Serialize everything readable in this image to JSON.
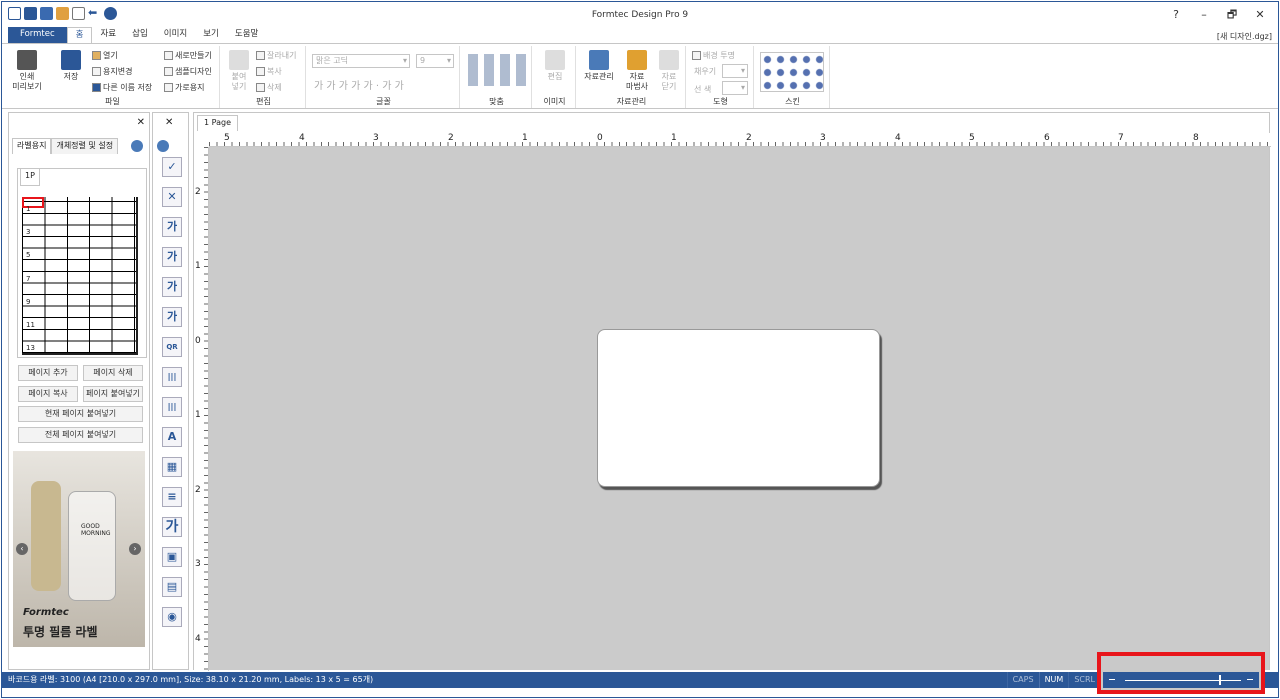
{
  "window": {
    "title": "Formtec Design Pro 9",
    "doc_name": "[새 디자인.dgz]",
    "controls": [
      "?",
      "–",
      "🗗",
      "✕"
    ]
  },
  "ribbon_tabs": [
    "Formtec",
    "홈",
    "자료",
    "삽입",
    "이미지",
    "보기",
    "도움말"
  ],
  "groups": {
    "file": {
      "label": "파일",
      "print": "인쇄\n미리보기",
      "save": "저장",
      "open": "열기",
      "paper": "용지변경",
      "saveas": "다른 이름 저장",
      "new": "새로만들기",
      "sample": "샘플디자인",
      "landscape": "가로용지"
    },
    "edit": {
      "label": "편집",
      "paste": "붙여\n넣기",
      "cut": "잘라내기",
      "copy": "복사",
      "delete": "삭제"
    },
    "font": {
      "label": "글꼴",
      "family": "맑은 고딕",
      "size": "9",
      "styles": "가 가 가 가 가 · 가 가"
    },
    "align": {
      "label": "맞춤"
    },
    "image": {
      "label": "이미지",
      "edit": "편집"
    },
    "data": {
      "label": "자료관리",
      "manage": "자료관리",
      "wizard": "자료\n마법사",
      "close": "자료\n닫기"
    },
    "shape": {
      "label": "도형",
      "transparent": "배경 투명",
      "fill": "채우기",
      "line": "선  색"
    },
    "skin": {
      "label": "스킨"
    }
  },
  "left_panel": {
    "tabs": [
      "라벨용지",
      "개체정렬 및 설정"
    ],
    "page_tab": "1P",
    "row_numbers": [
      "1",
      "3",
      "5",
      "7",
      "9",
      "11",
      "13"
    ],
    "buttons": {
      "add_page": "페이지 추가",
      "delete_page": "페이지 삭제",
      "copy_page": "페이지 복사",
      "paste_page": "페이지 붙여넣기",
      "paste_current": "현재 페이지 붙여넣기",
      "paste_all": "전체 페이지 붙여넣기"
    },
    "ad": {
      "brand": "Formtec",
      "title": "투명 필름 라벨",
      "bottle_text": "GOOD\nMORNING"
    }
  },
  "toolbox": [
    "✓",
    "✕",
    "가",
    "가",
    "가",
    "가",
    "QR",
    "|||",
    "|||",
    "A",
    "▦",
    "≡",
    "가",
    "▣",
    "▤",
    "◉"
  ],
  "document": {
    "tab": "1 Page",
    "ruler_top": [
      "5",
      "4",
      "3",
      "2",
      "1",
      "0",
      "1",
      "2",
      "3",
      "4",
      "5",
      "6",
      "7",
      "8"
    ],
    "ruler_left": [
      "2",
      "1",
      "0",
      "1",
      "2",
      "3",
      "4"
    ]
  },
  "status": {
    "text": "바코드용 라벨: 3100 (A4 [210.0 x 297.0 mm], Size: 38.10 x 21.20 mm,  Labels: 13 x 5 = 65개)",
    "caps": "CAPS",
    "num": "NUM",
    "scrl": "SCRL"
  },
  "colors": {
    "accent": "#2b5797",
    "highlight": "#e8151b"
  }
}
